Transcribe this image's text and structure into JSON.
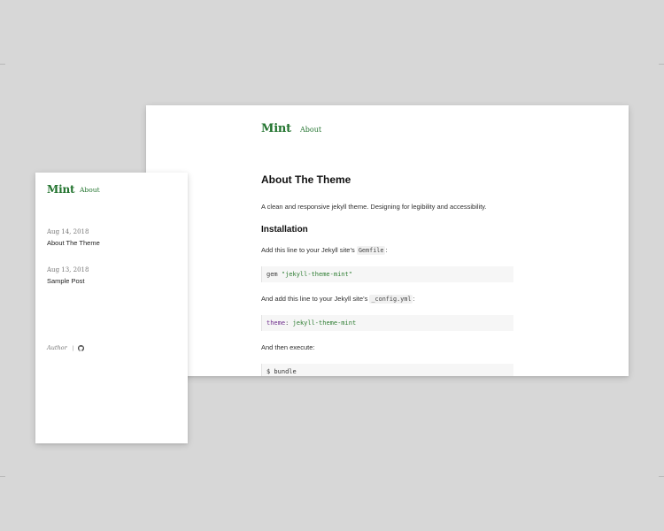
{
  "desktop": {
    "brand": "Mint",
    "nav": {
      "about": "About"
    },
    "article": {
      "title": "About The Theme",
      "intro": "A clean and responsive jekyll theme. Designing for legibility and accessibility.",
      "installation_title": "Installation",
      "gemfile_prefix": "Add this line to your Jekyll site’s ",
      "gemfile_code": "Gemfile",
      "gemfile_suffix": ":",
      "gem_line": {
        "keyword": "gem ",
        "value": "\"jekyll-theme-mint\""
      },
      "config_prefix": "And add this line to your Jekyll site’s ",
      "config_code": "_config.yml",
      "config_suffix": ":",
      "theme_line": {
        "key": "theme",
        "separator": ": ",
        "value": "jekyll-theme-mint"
      },
      "execute": "And then execute:",
      "bundle_command": "$ bundle"
    }
  },
  "mobile": {
    "brand": "Mint",
    "nav": {
      "about": "About"
    },
    "posts": [
      {
        "date": "Aug 14, 2018",
        "title": "About The Theme"
      },
      {
        "date": "Aug 13, 2018",
        "title": "Sample Post"
      }
    ],
    "footer": {
      "author": "Author",
      "separator": "|",
      "icon": "github-icon"
    }
  },
  "colors": {
    "background": "#d7d7d7",
    "card": "#ffffff",
    "brand_green": "#23742f",
    "code_background": "#f6f6f6",
    "string_green": "#2e7d32",
    "key_purple": "#6f2f8d"
  }
}
